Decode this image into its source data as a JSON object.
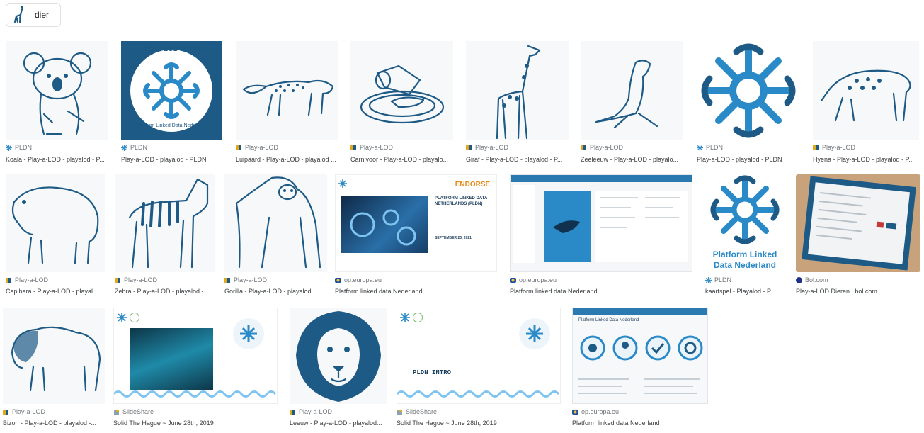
{
  "search_chip": {
    "label": "dier",
    "icon": "giraffe-icon"
  },
  "colors": {
    "ink": "#1d5a86",
    "accent": "#2a8ac7",
    "pldn_favicon": "#3a8fc4",
    "playalod_favicon": "#e0a81a",
    "europa_favicon": "#1f4fa0",
    "slideshare_favicon": "#8aa0b4"
  },
  "results": [
    {
      "source": "PLDN",
      "favicon": "snowflake-icon",
      "title": "Koala - Play-a-LOD - playalod - P...",
      "image": "koala"
    },
    {
      "source": "PLDN",
      "favicon": "snowflake-icon",
      "title": "Play-a-LOD - playalod - PLDN",
      "image": "play-a-lod-dieren-logo",
      "logo_top": "Play-a-LOD Dieren",
      "logo_bottom": "Platform Linked Data Nederland"
    },
    {
      "source": "Play-a-LOD",
      "favicon": "flag-icon",
      "title": "Luipaard - Play-a-LOD - playalod ...",
      "image": "leopard"
    },
    {
      "source": "Play-a-LOD",
      "favicon": "flag-icon",
      "title": "Carnivoor - Play-a-LOD - playalo...",
      "image": "carnivore-plate"
    },
    {
      "source": "Play-a-LOD",
      "favicon": "flag-icon",
      "title": "Giraf - Play-a-LOD - playalod - P...",
      "image": "giraffe"
    },
    {
      "source": "Play-a-LOD",
      "favicon": "flag-icon",
      "title": "Zeeleeuw - Play-a-LOD - playalo...",
      "image": "sea-lion"
    },
    {
      "source": "PLDN",
      "favicon": "snowflake-icon",
      "title": "Play-a-LOD - playalod - PLDN",
      "image": "pldn-logo"
    },
    {
      "source": "Play-a-LOD",
      "favicon": "flag-icon",
      "title": "Hyena - Play-a-LOD - playalod - P...",
      "image": "hyena"
    },
    {
      "source": "Play-a-LOD",
      "favicon": "flag-icon",
      "title": "Capibara - Play-a-LOD - playal...",
      "image": "capybara"
    },
    {
      "source": "Play-a-LOD",
      "favicon": "flag-icon",
      "title": "Zebra - Play-a-LOD - playalod -...",
      "image": "zebra"
    },
    {
      "source": "Play-a-LOD",
      "favicon": "flag-icon",
      "title": "Gorilla - Play-a-LOD - playalod ...",
      "image": "gorilla"
    },
    {
      "source": "op.europa.eu",
      "favicon": "europa-icon",
      "title": "Platform linked data Nederland",
      "image": "endorse-slide",
      "slide_brand": "ENDORSE.",
      "slide_heading": "PLATFORM LINKED DATA NETHERLANDS (PLDN)",
      "slide_date": "SEPTEMBER 23, 2021"
    },
    {
      "source": "op.europa.eu",
      "favicon": "europa-icon",
      "title": "Platform linked data Nederland",
      "image": "website-screenshot"
    },
    {
      "source": "PLDN",
      "favicon": "snowflake-icon",
      "title": "kaartspel - Playalod - P...",
      "image": "platform-linked-data-logo",
      "logo_text_1": "Platform Linked",
      "logo_text_2": "Data Nederland"
    },
    {
      "source": "Bol.com",
      "favicon": "bol-icon",
      "title": "Play-a-LOD Dieren | bol.com",
      "image": "game-box"
    },
    {
      "source": "Play-a-LOD",
      "favicon": "flag-icon",
      "title": "Bizon - Play-a-LOD - playalod -...",
      "image": "bison"
    },
    {
      "source": "SlideShare",
      "favicon": "slideshare-icon",
      "title": "Solid The Hague ~ June 28th, 2019",
      "image": "slide-solid-1"
    },
    {
      "source": "Play-a-LOD",
      "favicon": "flag-icon",
      "title": "Leeuw - Play-a-LOD - playalod...",
      "image": "lion"
    },
    {
      "source": "SlideShare",
      "favicon": "slideshare-icon",
      "title": "Solid The Hague ~ June 28th, 2019",
      "image": "slide-pldn-intro",
      "slide_text": "PLDN INTRO"
    },
    {
      "source": "op.europa.eu",
      "favicon": "europa-icon",
      "title": "Platform linked data Nederland",
      "image": "pldn-website-icons",
      "page_heading": "Platform Linked Data Nederland"
    }
  ]
}
